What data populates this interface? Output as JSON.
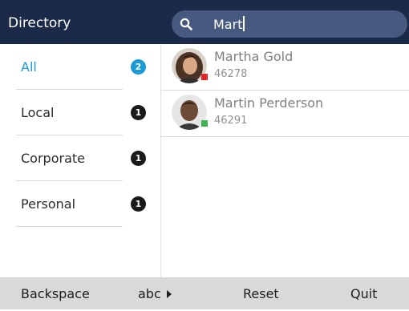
{
  "header": {
    "title": "Directory"
  },
  "search": {
    "icon": "search-icon",
    "value": "Mart"
  },
  "sidebar": {
    "items": [
      {
        "label": "All",
        "count": "2",
        "active": true
      },
      {
        "label": "Local",
        "count": "1"
      },
      {
        "label": "Corporate",
        "count": "1"
      },
      {
        "label": "Personal",
        "count": "1"
      }
    ]
  },
  "contacts": [
    {
      "name": "Martha Gold",
      "number": "46278",
      "status_color": "#e0242b"
    },
    {
      "name": "Martin Perderson",
      "number": "46291",
      "status_color": "#3fb34f"
    }
  ],
  "softkeys": {
    "backspace": "Backspace",
    "abc": "abc",
    "reset": "Reset",
    "quit": "Quit"
  },
  "colors": {
    "header_bg": "#1c2a4a",
    "accent": "#1a9ad6",
    "search_bg": "#46597f",
    "softkey_bar": "#d9d9d9"
  }
}
